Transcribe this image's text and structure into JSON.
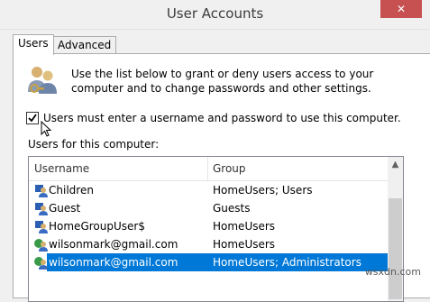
{
  "window": {
    "title": "User Accounts",
    "close_glyph": "✕"
  },
  "tabs": [
    {
      "label": "Users",
      "active": true
    },
    {
      "label": "Advanced",
      "active": false
    }
  ],
  "users_tab": {
    "description": "Use the list below to grant or deny users access to your computer and to change passwords and other settings.",
    "require_login_checkbox": {
      "label": "Users must enter a username and password to use this computer.",
      "checked": true
    },
    "users_list_label": "Users for this computer:",
    "columns": [
      "Username",
      "Group"
    ],
    "rows": [
      {
        "username": "Children",
        "group": "HomeUsers; Users",
        "icon": "local-user-icon"
      },
      {
        "username": "Guest",
        "group": "Guests",
        "icon": "local-user-icon"
      },
      {
        "username": "HomeGroupUser$",
        "group": "HomeUsers",
        "icon": "local-user-icon"
      },
      {
        "username": "wilsonmark@gmail.com",
        "group": "HomeUsers",
        "icon": "microsoft-account-icon"
      },
      {
        "username": "wilsonmark@gmail.com",
        "group": "HomeUsers; Administrators",
        "icon": "microsoft-account-icon",
        "selected": true
      }
    ]
  },
  "watermark": "wsxdn.com",
  "colors": {
    "selection": "#0078d7",
    "close_button": "#c75050"
  }
}
